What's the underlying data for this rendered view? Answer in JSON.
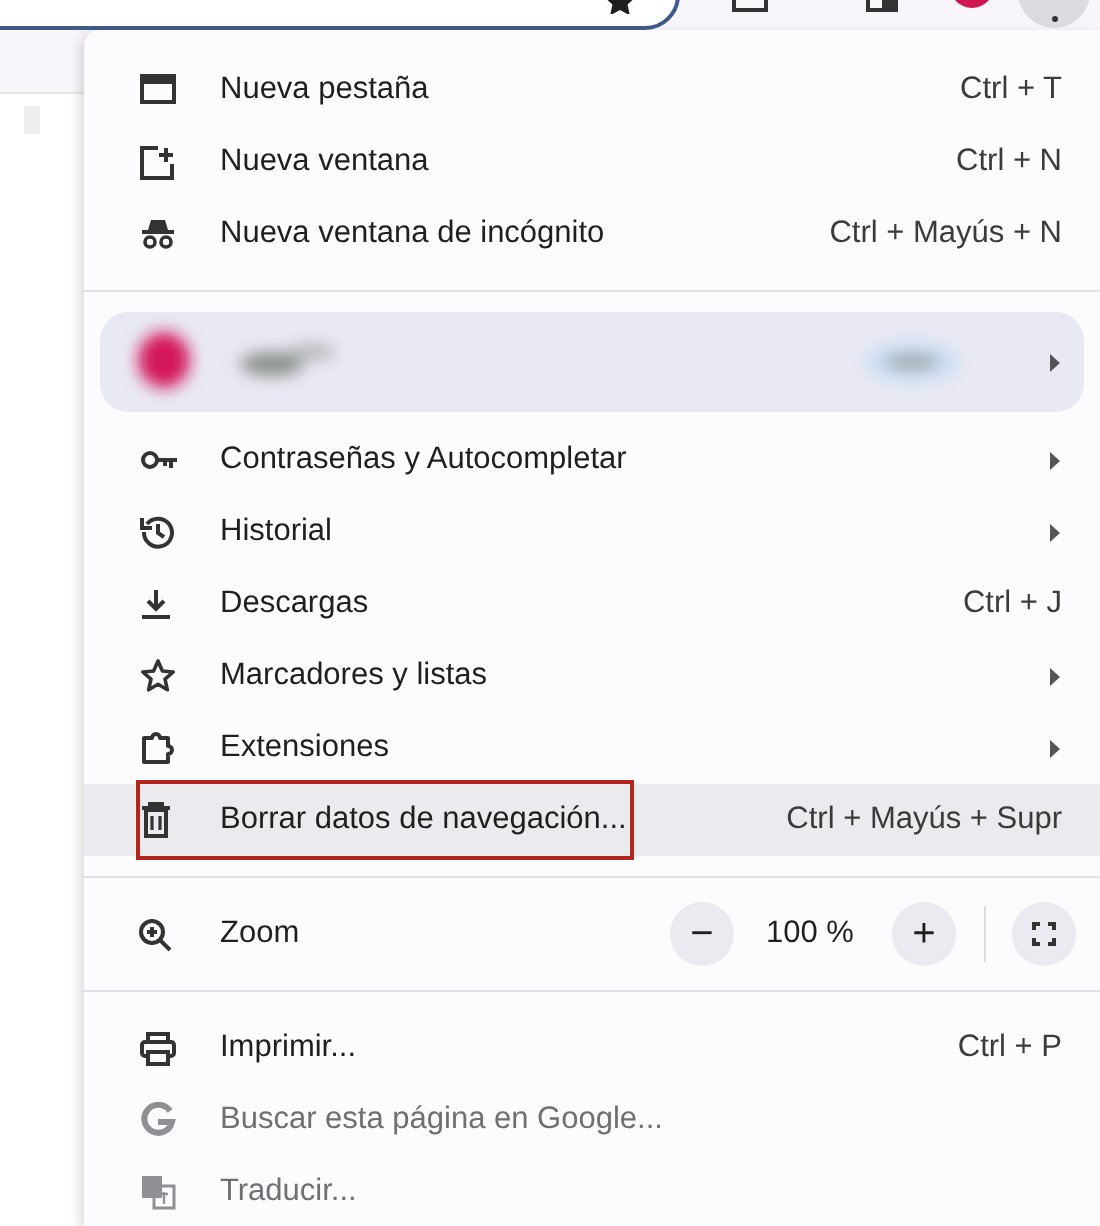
{
  "menu": [
    {
      "kind": "item",
      "label": "Nueva pestaña",
      "shortcut": "Ctrl + T",
      "submenu": false,
      "disabled": false,
      "highlighted": false,
      "outlined": false
    },
    {
      "kind": "item",
      "label": "Nueva ventana",
      "shortcut": "Ctrl + N",
      "submenu": false,
      "disabled": false,
      "highlighted": false,
      "outlined": false
    },
    {
      "kind": "item",
      "label": "Nueva ventana de incógnito",
      "shortcut": "Ctrl + Mayús + N",
      "submenu": false,
      "disabled": false,
      "highlighted": false,
      "outlined": false
    },
    {
      "kind": "divider"
    },
    {
      "kind": "profile",
      "submenu": true
    },
    {
      "kind": "item",
      "label": "Contraseñas y Autocompletar",
      "submenu": true,
      "disabled": false,
      "highlighted": false,
      "outlined": false
    },
    {
      "kind": "item",
      "label": "Historial",
      "submenu": true,
      "disabled": false,
      "highlighted": false,
      "outlined": false
    },
    {
      "kind": "item",
      "label": "Descargas",
      "shortcut": "Ctrl + J",
      "submenu": false,
      "disabled": false,
      "highlighted": false,
      "outlined": false
    },
    {
      "kind": "item",
      "label": "Marcadores y listas",
      "submenu": true,
      "disabled": false,
      "highlighted": false,
      "outlined": false
    },
    {
      "kind": "item",
      "label": "Extensiones",
      "submenu": true,
      "disabled": false,
      "highlighted": false,
      "outlined": false
    },
    {
      "kind": "item",
      "label": "Borrar datos de navegación...",
      "shortcut": "Ctrl + Mayús + Supr",
      "submenu": false,
      "disabled": false,
      "highlighted": true,
      "outlined": true
    },
    {
      "kind": "divider"
    },
    {
      "kind": "zoom",
      "label": "Zoom",
      "minus": "−",
      "value": "100 %",
      "plus": "+"
    },
    {
      "kind": "divider"
    },
    {
      "kind": "item",
      "label": "Imprimir...",
      "shortcut": "Ctrl + P",
      "submenu": false,
      "disabled": false,
      "highlighted": false,
      "outlined": false
    },
    {
      "kind": "item",
      "label": "Buscar esta página en Google...",
      "submenu": false,
      "disabled": true,
      "highlighted": false,
      "outlined": false
    },
    {
      "kind": "item",
      "label": "Traducir...",
      "submenu": false,
      "disabled": true,
      "highlighted": false,
      "outlined": false
    }
  ]
}
